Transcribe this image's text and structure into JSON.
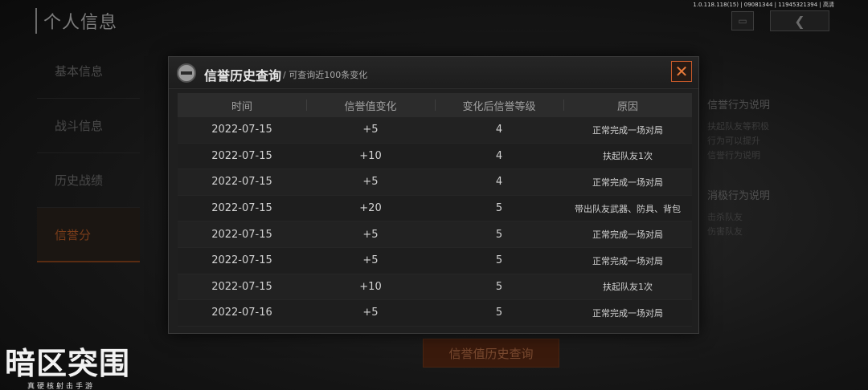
{
  "page": {
    "title": "个人信息",
    "version": "1.0.118.118(15) | 09081344 | 11945321394 | 高清"
  },
  "side_menu": [
    {
      "label": "基本信息"
    },
    {
      "label": "战斗信息"
    },
    {
      "label": "历史战绩"
    },
    {
      "label": "信誉分"
    }
  ],
  "right_panel": {
    "positive_heading": "信誉行为说明",
    "positive_lines": [
      "扶起队友等积极",
      "行为可以提升",
      "信誉行为说明"
    ],
    "negative_heading": "消极行为说明",
    "negative_lines": [
      "击杀队友",
      "伤害队友"
    ]
  },
  "bottom_button": "信誉值历史查询",
  "logo": {
    "text": "暗区突围",
    "sub": "真硬核射击手游"
  },
  "modal": {
    "title": "信誉历史查询",
    "subtitle": "/ 可查询近100条变化",
    "close_symbol": "✕",
    "columns": [
      "时间",
      "信誉值变化",
      "变化后信誉等级",
      "原因"
    ],
    "rows": [
      {
        "time": "2022-07-15",
        "change": "+5",
        "level": "4",
        "reason": "正常完成一场对局"
      },
      {
        "time": "2022-07-15",
        "change": "+10",
        "level": "4",
        "reason": "扶起队友1次"
      },
      {
        "time": "2022-07-15",
        "change": "+5",
        "level": "4",
        "reason": "正常完成一场对局"
      },
      {
        "time": "2022-07-15",
        "change": "+20",
        "level": "5",
        "reason": "带出队友武器、防具、背包"
      },
      {
        "time": "2022-07-15",
        "change": "+5",
        "level": "5",
        "reason": "正常完成一场对局"
      },
      {
        "time": "2022-07-15",
        "change": "+5",
        "level": "5",
        "reason": "正常完成一场对局"
      },
      {
        "time": "2022-07-15",
        "change": "+10",
        "level": "5",
        "reason": "扶起队友1次"
      },
      {
        "time": "2022-07-16",
        "change": "+5",
        "level": "5",
        "reason": "正常完成一场对局"
      }
    ]
  },
  "colors": {
    "accent": "#e87a3a",
    "background": "#111111",
    "modal": "#1f1f1f"
  }
}
